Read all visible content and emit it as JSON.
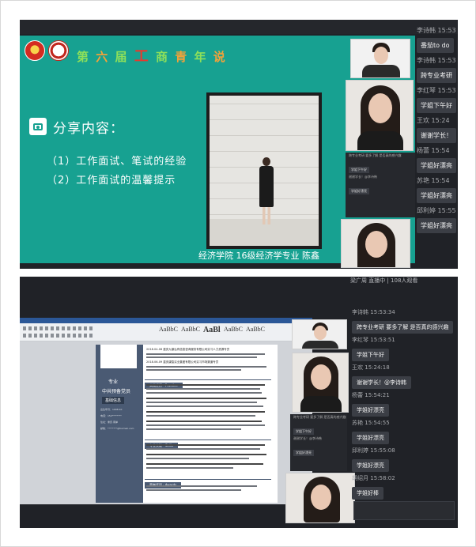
{
  "panel1": {
    "slide": {
      "event_title": [
        "第",
        "六",
        "届",
        "工",
        "商",
        "青",
        "年",
        "说"
      ],
      "share_heading": "分享内容：",
      "items": [
        "（1）工作面试、笔试的经验",
        "（2）工作面试的温馨提示"
      ],
      "caption": "经济学院 16级经济学专业 陈鑫"
    },
    "mini_chat": [
      "跨专业考研 要多了解 是否真的感兴趣",
      "学姐下午好",
      "谢谢学长！@李诗韩",
      "学姐好漂亮"
    ],
    "chat": [
      {
        "name": "李诗韩",
        "time": "15:53",
        "msg": "番茄to do"
      },
      {
        "name": "李诗韩",
        "time": "15:53",
        "msg": "跨专业考研"
      },
      {
        "name": "李红琴",
        "time": "15:53",
        "msg": "学姐下午好"
      },
      {
        "name": "王欢",
        "time": "15:24",
        "msg": "谢谢学长！"
      },
      {
        "name": "杨蕾",
        "time": "15:54",
        "msg": "学姐好漂亮"
      },
      {
        "name": "苏艳",
        "time": "15:54",
        "msg": "学姐好漂亮"
      },
      {
        "name": "邱利婷",
        "time": "15:55",
        "msg": "学姐好漂亮"
      }
    ]
  },
  "panel2": {
    "header": "梁广周 直播中 | 108人观看",
    "resume": {
      "major": "专业",
      "party": "中共预备党员",
      "basic_info": "基础信息",
      "info_lines": [
        "出生年月：1998.10",
        "电话：152********",
        "住址：重庆·南岸",
        "邮箱：********@foxmail.com"
      ],
      "section_internship": "实践经历 · Practice",
      "section_honor": "荣誉奖项 · Awards",
      "section_skill": "专业技能 · Skills",
      "entries": [
        "2018.04-06  重庆九鼎弘有信息咨询服务有限公司实习人力资源专员",
        "2018.06-09  重庆康智实业集团有限公司实习市场渠道专员"
      ]
    },
    "ribbon_styles": [
      "AaBbC",
      "AaBbC",
      "AaBl",
      "AaBbC",
      "AaBbC"
    ],
    "chat": [
      {
        "name": "李诗韩",
        "time": "15:53:34",
        "msg": "跨专业考研 要多了解 是否真的感兴趣"
      },
      {
        "name": "李红琴",
        "time": "15:53:51",
        "msg": "学姐下午好"
      },
      {
        "name": "王欢",
        "time": "15:24:18",
        "msg": "谢谢学长！@李诗韩"
      },
      {
        "name": "杨蕾",
        "time": "15:54:21",
        "msg": "学姐好漂亮"
      },
      {
        "name": "苏艳",
        "time": "15:54:55",
        "msg": "学姐好漂亮"
      },
      {
        "name": "邱利婷",
        "time": "15:55:08",
        "msg": "学姐好漂亮"
      },
      {
        "name": "胡绍月",
        "time": "15:58:02",
        "msg": "学姐好棒"
      }
    ]
  },
  "colors": {
    "slide_bg": "#17a191",
    "resume_accent": "#4a5a73",
    "chat_bg": "#202227",
    "bubble": "#3b3e45"
  }
}
